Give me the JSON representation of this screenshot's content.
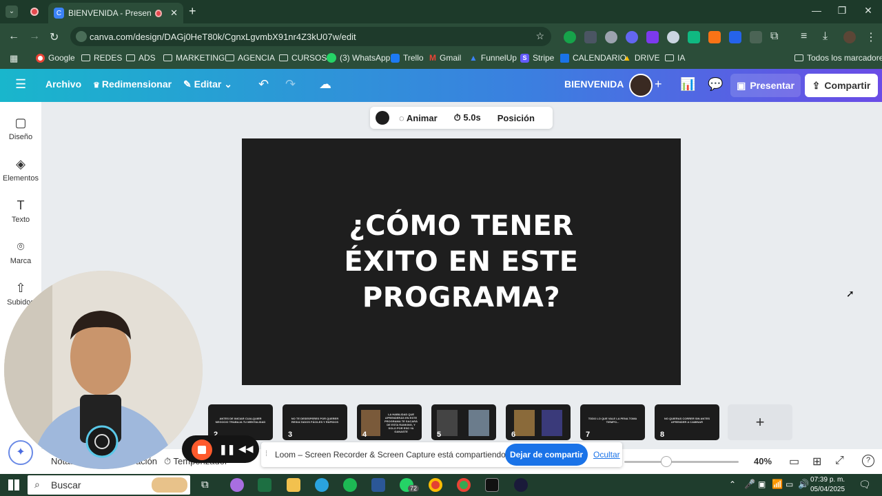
{
  "browser": {
    "tab_title": "BIENVENIDA - Presentación",
    "url": "canva.com/design/DAGj0HeT80k/CgnxLgvmbX91nr4Z3kU07w/edit",
    "bookmarks": [
      "Google",
      "REDES",
      "ADS",
      "MARKETING",
      "AGENCIA",
      "CURSOS",
      "(3) WhatsApp",
      "Trello",
      "Gmail",
      "FunnelUp",
      "Stripe",
      "CALENDARIO",
      "DRIVE",
      "IA"
    ],
    "all_bookmarks": "Todos los marcadores",
    "extension_badge": "18"
  },
  "canva": {
    "menu": {
      "archivo": "Archivo",
      "redimensionar": "Redimensionar",
      "editar": "Editar"
    },
    "design_title": "BIENVENIDA",
    "presentar": "Presentar",
    "compartir": "Compartir",
    "sidebar": [
      "Diseño",
      "Elementos",
      "Texto",
      "Marca",
      "Subidos"
    ],
    "toolbar": {
      "animar": "Animar",
      "duration": "5.0s",
      "posicion": "Posición"
    },
    "slide_title": "¿CÓMO TENER ÉXITO EN ESTE PROGRAMA?",
    "thumbnails": [
      {
        "num": "2",
        "text": "ANTES DE INICIAR CUALQUIER NEGOCIO TRABAJA TU MENTALIDAD"
      },
      {
        "num": "3",
        "text": "NO TE DESESPERES POR QUERER RESULTADOS FÁCILES Y RÁPIDOS"
      },
      {
        "num": "4",
        "text": "LA HABILIDAD QUE APRENDERÁS EN ESTE PROGRAMA TE SACARÁ DE ESTA RANKING, Y SOLO POR ESO YA GANASTE"
      },
      {
        "num": "5",
        "text": ""
      },
      {
        "num": "6",
        "text": ""
      },
      {
        "num": "7",
        "text": "TODO LO QUE VALE LA PENA TOMA TIEMPO..."
      },
      {
        "num": "8",
        "text": "NO QUIERAS CORRER SIN ANTES APRENDER A CAMINAR"
      }
    ],
    "bottom": {
      "notas": "Notas",
      "duracion": "Duración",
      "temporizador": "Temporizador",
      "zoom": "40%"
    }
  },
  "loom": {
    "banner_text": "Loom – Screen Recorder & Screen Capture está compartiendo tu pantalla.",
    "stop_sharing": "Dejar de compartir",
    "hide": "Ocultar"
  },
  "taskbar": {
    "search_placeholder": "Buscar",
    "whatsapp_badge": "72",
    "time": "07:39 p. m.",
    "date": "05/04/2025"
  }
}
